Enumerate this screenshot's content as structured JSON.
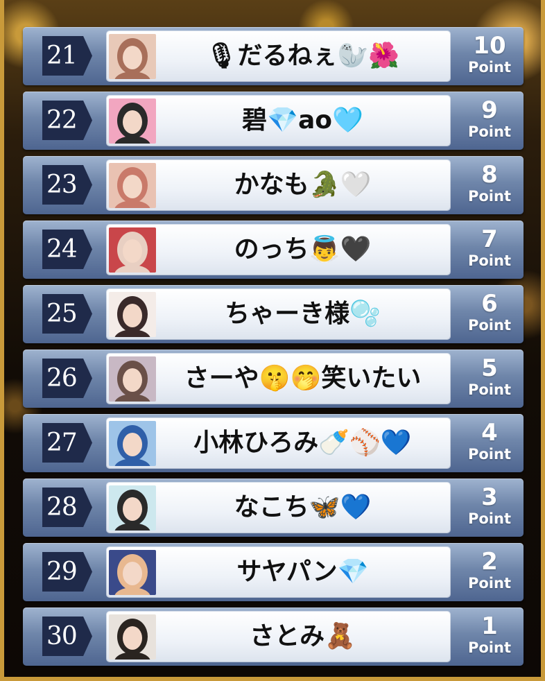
{
  "ranking": [
    {
      "rank": "21",
      "name": "🎙だるねぇ🦭🌺",
      "points": "10",
      "points_label": "Point",
      "avatar_colors": [
        "#e8c9b8",
        "#a86f5a"
      ]
    },
    {
      "rank": "22",
      "name": "碧💎ao🩵",
      "points": "9",
      "points_label": "Point",
      "avatar_colors": [
        "#f2a6c0",
        "#2a2a2a"
      ]
    },
    {
      "rank": "23",
      "name": "かなも🐊🤍",
      "points": "8",
      "points_label": "Point",
      "avatar_colors": [
        "#e9c2b2",
        "#c97a6a"
      ]
    },
    {
      "rank": "24",
      "name": "のっち👼🖤",
      "points": "7",
      "points_label": "Point",
      "avatar_colors": [
        "#c9464a",
        "#e8cfc2"
      ]
    },
    {
      "rank": "25",
      "name": "ちゃーき様🫧",
      "points": "6",
      "points_label": "Point",
      "avatar_colors": [
        "#f4ece8",
        "#3a2a2a"
      ]
    },
    {
      "rank": "26",
      "name": "さーや🤫🤭笑いたい",
      "points": "5",
      "points_label": "Point",
      "avatar_colors": [
        "#c8b8c4",
        "#6a5048"
      ]
    },
    {
      "rank": "27",
      "name": "小林ひろみ🍼⚾️💙",
      "points": "4",
      "points_label": "Point",
      "avatar_colors": [
        "#9ec4e8",
        "#2f5fa8"
      ]
    },
    {
      "rank": "28",
      "name": "なこち🦋💙",
      "points": "3",
      "points_label": "Point",
      "avatar_colors": [
        "#cde8ee",
        "#2a2a2a"
      ]
    },
    {
      "rank": "29",
      "name": "サヤパン💎",
      "points": "2",
      "points_label": "Point",
      "avatar_colors": [
        "#3a4a8a",
        "#e8b890"
      ]
    },
    {
      "rank": "30",
      "name": "さとみ🧸",
      "points": "1",
      "points_label": "Point",
      "avatar_colors": [
        "#e8e2dc",
        "#2a2420"
      ]
    }
  ]
}
